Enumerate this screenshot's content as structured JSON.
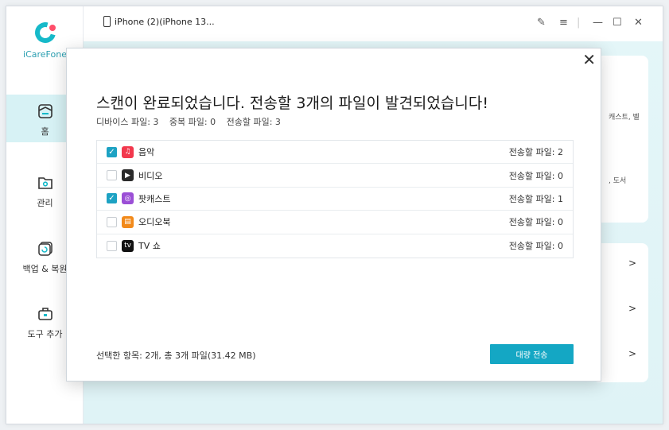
{
  "app": {
    "name": "iCareFone"
  },
  "device": {
    "name": "iPhone (2)(iPhone 13..."
  },
  "sidebar": {
    "items": [
      {
        "label": "홈",
        "icon": "home-icon",
        "active": true
      },
      {
        "label": "관리",
        "icon": "folder-gear-icon",
        "active": false
      },
      {
        "label": "백업 & 복원",
        "icon": "backup-restore-icon",
        "active": false
      },
      {
        "label": "도구 추가",
        "icon": "toolbox-icon",
        "active": false
      }
    ]
  },
  "background": {
    "snippet1": "캐스트, 벨",
    "snippet2": ", 도서",
    "chevrons": [
      ">",
      ">",
      ">"
    ]
  },
  "dialog": {
    "title": "스캔이 완료되었습니다. 전송할 3개의 파일이 발견되었습니다!",
    "stats": {
      "device_files": "디바이스 파일: 3",
      "duplicate_files": "중복 파일: 0",
      "transfer_files": "전송할 파일: 3"
    },
    "items": [
      {
        "label": "음악",
        "count": "전송할 파일: 2",
        "checked": true,
        "icon": "music-icon",
        "color": "#f2384d"
      },
      {
        "label": "비디오",
        "count": "전송할 파일: 0",
        "checked": false,
        "icon": "clapper-icon",
        "color": "#2a2a2a"
      },
      {
        "label": "팟캐스트",
        "count": "전송할 파일: 1",
        "checked": true,
        "icon": "podcast-icon",
        "color": "#9b4fd6"
      },
      {
        "label": "오디오북",
        "count": "전송할 파일: 0",
        "checked": false,
        "icon": "audiobook-icon",
        "color": "#f28a1b"
      },
      {
        "label": "TV 쇼",
        "count": "전송할 파일: 0",
        "checked": false,
        "icon": "appletv-icon",
        "color": "#111111"
      }
    ],
    "selection": "선택한 항목: 2개, 총 3개 파일(31.42 MB)",
    "transfer_button": "대량 전송"
  },
  "colors": {
    "accent": "#14a7c4",
    "active_nav": "#d7f2f5"
  }
}
